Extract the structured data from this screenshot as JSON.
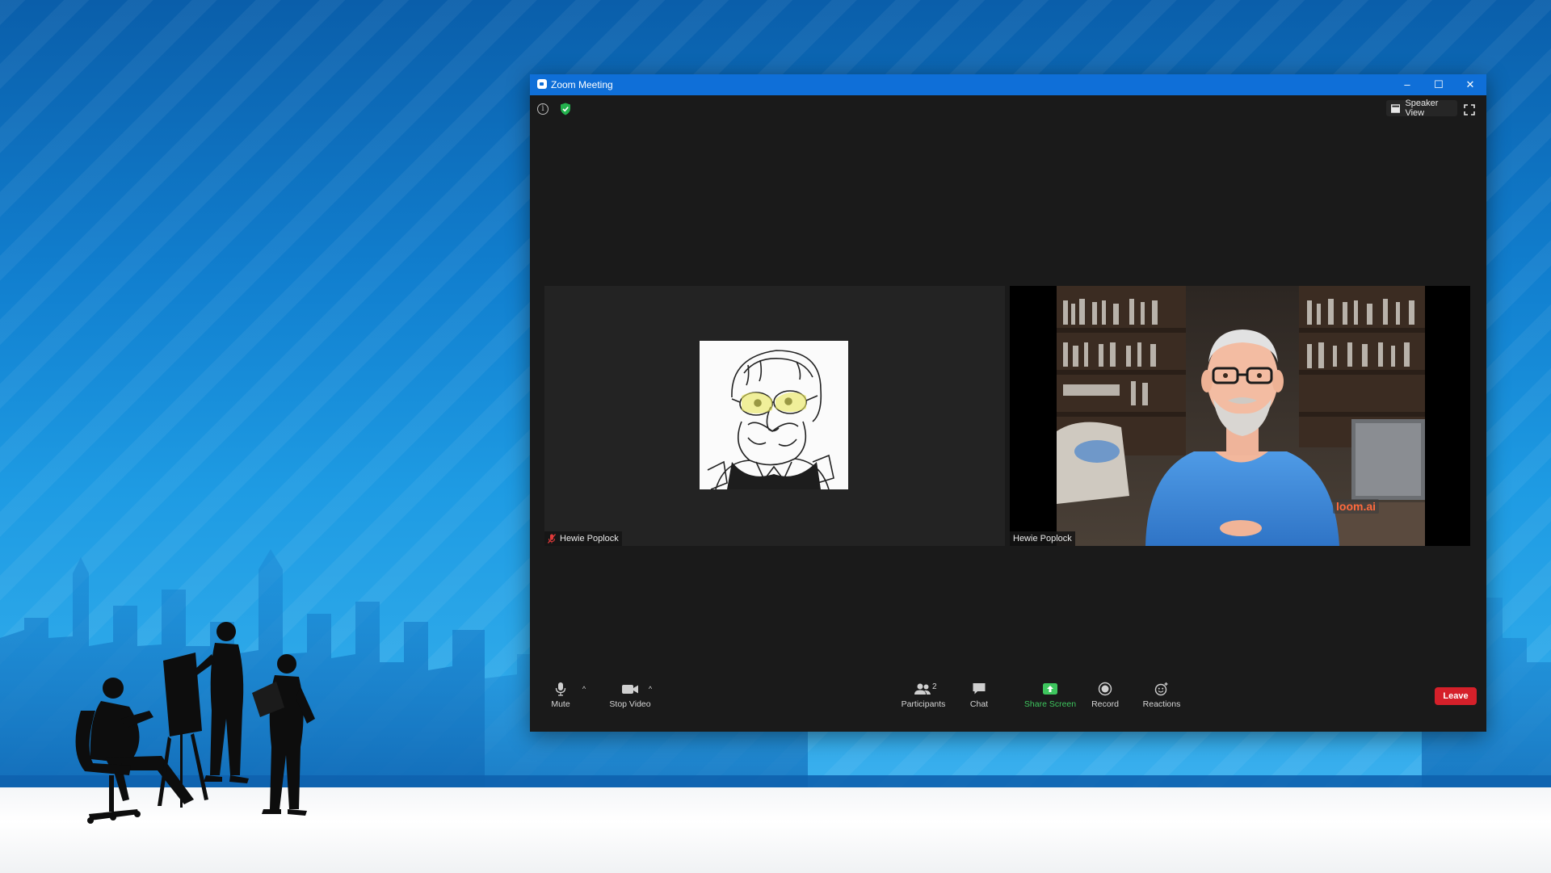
{
  "window": {
    "title": "Zoom Meeting",
    "minimize_glyph": "–",
    "maximize_glyph": "☐",
    "close_glyph": "✕"
  },
  "top_bar": {
    "speaker_view_label": "Speaker View",
    "info_glyph": "i"
  },
  "participants_tiles": [
    {
      "name": "Hewie Poplock",
      "muted": true
    },
    {
      "name": "Hewie Poplock",
      "muted": false
    }
  ],
  "watermark": {
    "text": "loom.ai"
  },
  "toolbar": {
    "mute_label": "Mute",
    "stop_video_label": "Stop Video",
    "participants_label": "Participants",
    "participants_count": "2",
    "chat_label": "Chat",
    "share_screen_label": "Share Screen",
    "record_label": "Record",
    "reactions_label": "Reactions",
    "leave_label": "Leave",
    "caret_glyph": "^"
  },
  "colors": {
    "titlebar": "#0f6fd8",
    "meeting_bg": "#1a1a1a",
    "share_green": "#3ec65e",
    "leave_red": "#d5202a",
    "loom_orange": "#ff6a3d"
  },
  "icons": [
    "zoom-app-icon",
    "info-icon",
    "shield-icon",
    "grid-icon",
    "fullscreen-icon",
    "muted-mic-icon",
    "mic-icon",
    "video-camera-icon",
    "participants-icon",
    "chat-icon",
    "share-screen-icon",
    "record-icon",
    "reactions-icon"
  ]
}
